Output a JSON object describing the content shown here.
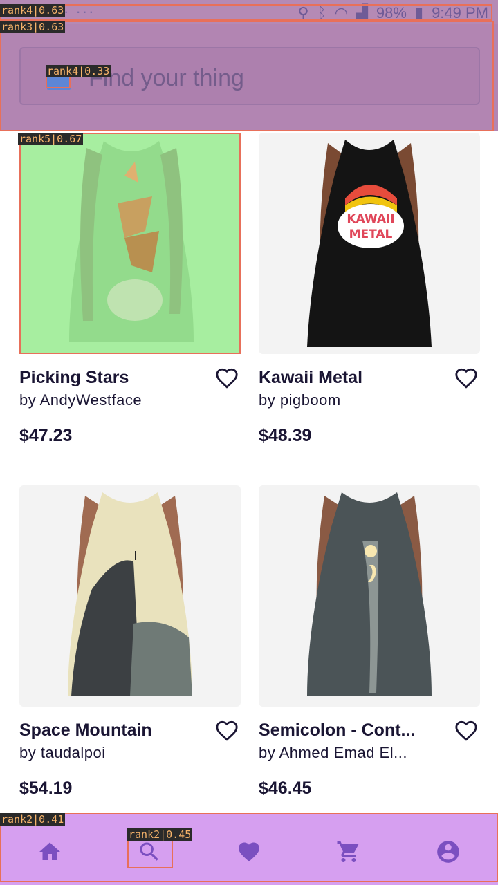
{
  "status_bar": {
    "left": "· ···",
    "battery": "98%",
    "time": "9:49 PM"
  },
  "search": {
    "placeholder": "Find your thing"
  },
  "products": [
    {
      "title": "Picking Stars",
      "artist": "by AndyWestface",
      "price": "$47.23"
    },
    {
      "title": "Kawaii Metal",
      "artist": "by pigboom",
      "price": "$48.39"
    },
    {
      "title": "Space Mountain",
      "artist": "by taudalpoi",
      "price": "$54.19"
    },
    {
      "title": "Semicolon - Cont...",
      "artist": "by Ahmed Emad El...",
      "price": "$46.45"
    }
  ],
  "annotations": {
    "status": "rank4|0.63",
    "header": "rank3|0.63",
    "search_icon": "rank4|0.33",
    "first_card": "rank5|0.67",
    "bottom_nav": "rank2|0.41",
    "nav_search": "rank2|0.45"
  },
  "nav": [
    {
      "icon": "home-icon"
    },
    {
      "icon": "search-icon"
    },
    {
      "icon": "heart-icon"
    },
    {
      "icon": "cart-icon"
    },
    {
      "icon": "account-icon"
    }
  ],
  "colors": {
    "header": "#b285b2",
    "bottom_nav": "#d69ff0",
    "accent": "#7b4fc0",
    "text": "#1a1533"
  }
}
